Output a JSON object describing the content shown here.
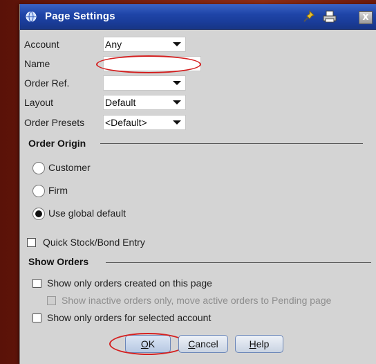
{
  "window": {
    "title": "Page Settings",
    "close_label": "X"
  },
  "form": {
    "account": {
      "label": "Account",
      "value": "Any"
    },
    "name": {
      "label": "Name",
      "value": ""
    },
    "order_ref": {
      "label": "Order Ref.",
      "value": ""
    },
    "layout": {
      "label": "Layout",
      "value": "Default"
    },
    "order_presets": {
      "label": "Order Presets",
      "value": "<Default>"
    }
  },
  "order_origin": {
    "title": "Order Origin",
    "options": [
      {
        "label": "Customer",
        "selected": false
      },
      {
        "label": "Firm",
        "selected": false
      },
      {
        "label": "Use global default",
        "selected": true
      }
    ]
  },
  "quick_entry": {
    "label": "Quick Stock/Bond Entry",
    "checked": false
  },
  "show_orders": {
    "title": "Show Orders",
    "options": [
      {
        "label": "Show only orders created on this page",
        "checked": false,
        "enabled": true
      },
      {
        "label": "Show inactive orders only, move active orders to Pending page",
        "checked": false,
        "enabled": false
      },
      {
        "label": "Show only orders for selected account",
        "checked": false,
        "enabled": true
      }
    ]
  },
  "buttons": {
    "ok": {
      "accel": "O",
      "rest": "K"
    },
    "cancel": {
      "accel": "C",
      "rest": "ancel"
    },
    "help": {
      "accel": "H",
      "rest": "elp"
    }
  },
  "annotation_color": "#d42020"
}
